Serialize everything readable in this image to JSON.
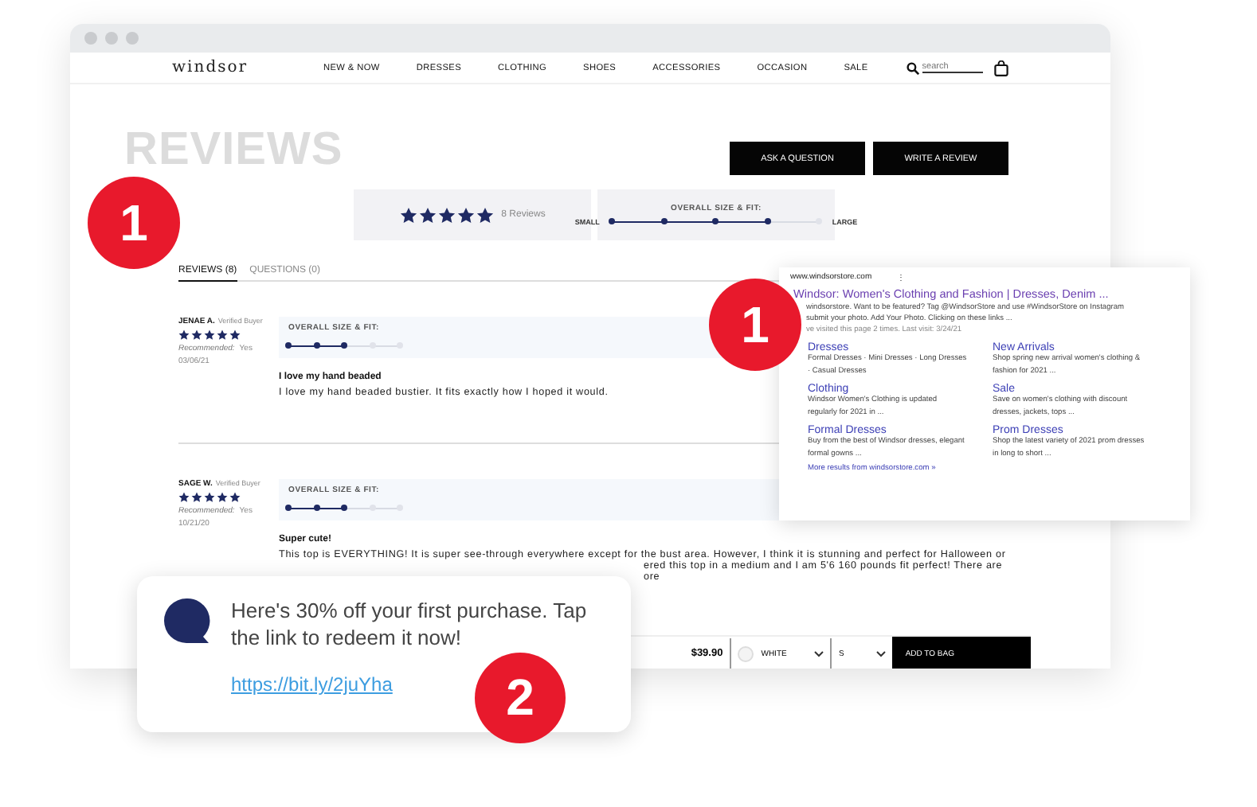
{
  "window": {
    "nav": {
      "logo": "windsor",
      "items": [
        "NEW & NOW",
        "DRESSES",
        "CLOTHING",
        "SHOES",
        "ACCESSORIES",
        "OCCASION",
        "SALE"
      ],
      "search": {
        "placeholder": "search"
      }
    },
    "heading": "REVIEWS",
    "buttons": [
      "ASK A QUESTION",
      "WRITE A REVIEW"
    ],
    "summary": {
      "stars": 5,
      "count": "8 Reviews",
      "fit": {
        "title": "OVERALL SIZE & FIT:",
        "low": "SMALL",
        "high": "LARGE",
        "level": 0.75
      }
    },
    "tabs": [
      {
        "label": "REVIEWS (8)",
        "selected": true
      },
      {
        "label": "QUESTIONS (0)",
        "selected": false
      }
    ],
    "reviews": [
      {
        "name": "JENAE A.",
        "badge": "Verified Buyer",
        "stars": 5,
        "recommended_label": "Recommended:",
        "recommended": "Yes",
        "date": "03/06/21",
        "fit": {
          "title": "OVERALL SIZE & FIT:",
          "level": 0.5
        },
        "title": "I love my hand beaded",
        "body": [
          "I love my hand beaded bustier. It fits exactly how I hoped it would."
        ]
      },
      {
        "name": "SAGE W.",
        "badge": "Verified Buyer",
        "stars": 5,
        "recommended_label": "Recommended:",
        "recommended": "Yes",
        "date": "10/21/20",
        "fit": {
          "title": "OVERALL SIZE & FIT:",
          "level": 0.5
        },
        "title": "Super cute!",
        "body": [
          "This top is EVERYTHING! It is super see-through everywhere except for the bust area. However, I think it is stunning and perfect for Halloween or",
          "ered this top in a medium and I am 5'6 160 pounds fit perfect! There are",
          "ore"
        ]
      }
    ],
    "product_bar": {
      "price": "$39.90",
      "color_option": "WHITE",
      "size": "S",
      "button": "ADD TO BAG"
    }
  },
  "search_result": {
    "url": "www.windsorstore.com",
    "menu": "⋮",
    "title": "Windsor: Women's Clothing and Fashion | Dresses, Denim ...",
    "snippet": [
      "windsorstore. Want to be featured? Tag @WindsorStore and use #WindsorStore on Instagram",
      "submit your photo. Add Your Photo. Clicking on these links ...",
      "ve visited this page 2 times. Last visit: 3/24/21"
    ],
    "sitelinks": [
      {
        "title": "Dresses",
        "text": "Formal Dresses · Mini Dresses · Long Dresses · Casual Dresses"
      },
      {
        "title": "New Arrivals",
        "text": "Shop spring new arrival women's clothing & fashion for 2021 ..."
      },
      {
        "title": "Clothing",
        "text": "Windsor Women's Clothing is updated regularly for 2021 in ..."
      },
      {
        "title": "Sale",
        "text": "Save on women's clothing with discount dresses, jackets, tops ..."
      },
      {
        "title": "Formal Dresses",
        "text": "Buy from the best of Windsor dresses, elegant formal gowns ..."
      },
      {
        "title": "Prom Dresses",
        "text": "Shop the latest variety of 2021 prom dresses in long to short ..."
      }
    ],
    "more": "More results from windsorstore.com »"
  },
  "sms": {
    "message": "Here's 30% off your first purchase. Tap the link to redeem it now!",
    "link": "https://bit.ly/2juYha"
  },
  "markers": [
    "1",
    "1",
    "2"
  ]
}
